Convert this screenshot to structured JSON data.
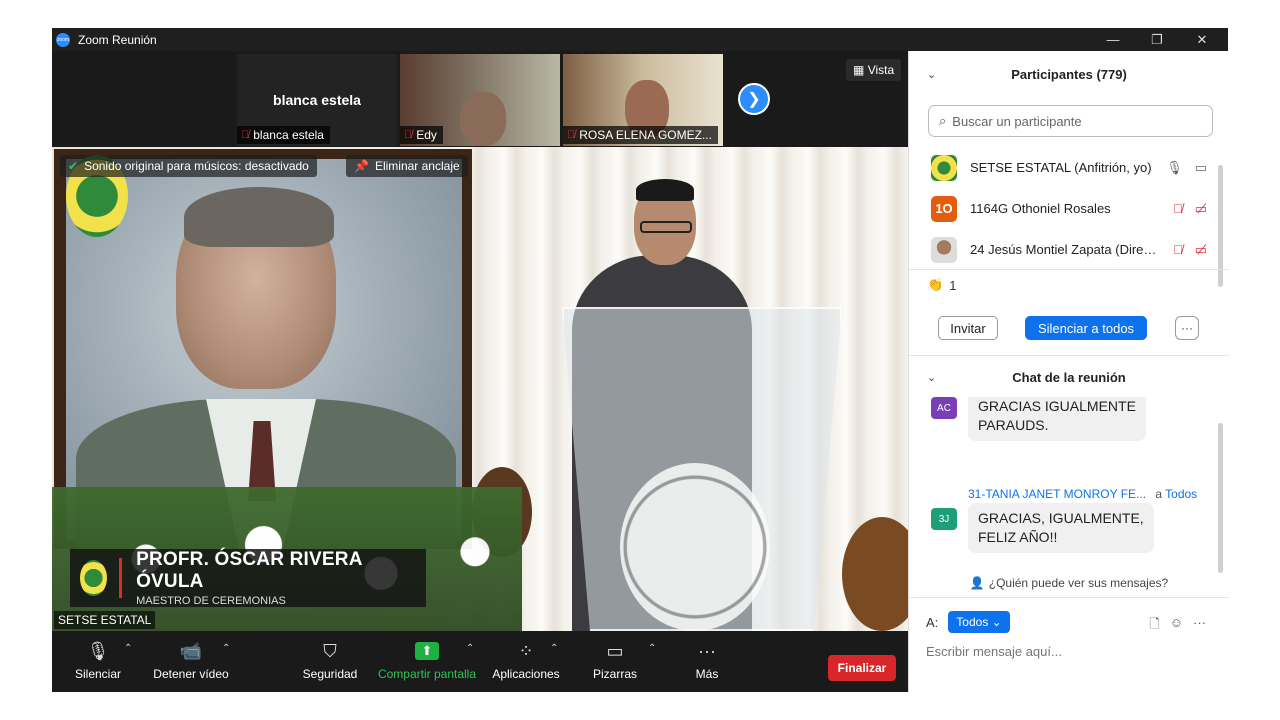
{
  "window": {
    "title": "Zoom Reunión",
    "controls": [
      "—",
      "❐",
      "✕"
    ]
  },
  "gallery": {
    "tiles": [
      {
        "big_name": "blanca estela",
        "label": "blanca estela"
      },
      {
        "label": "Edy"
      },
      {
        "label": "ROSA ELENA GOMEZ..."
      }
    ],
    "view_label": "Vista"
  },
  "main_video": {
    "badge_original_sound": "Sonido original para músicos: desactivado",
    "badge_unpin": "Eliminar anclaje",
    "lower_third_name": "PROFR. ÓSCAR RIVERA ÓVULA",
    "lower_third_role": "MAESTRO DE CEREMONIAS",
    "speaker_name": "SETSE ESTATAL"
  },
  "toolbar": {
    "mute": "Silenciar",
    "stop_video": "Detener vídeo",
    "security": "Seguridad",
    "share": "Compartir pantalla",
    "apps": "Aplicaciones",
    "whiteboards": "Pizarras",
    "more": "Más",
    "end": "Finalizar"
  },
  "participants": {
    "header": "Participantes (779)",
    "search_placeholder": "Buscar un participante",
    "list": [
      {
        "name": "SETSE ESTATAL (Anfitrión, yo)",
        "avatar": "logo",
        "mic": "on",
        "video": "on"
      },
      {
        "name": "1164G Othoniel Rosales",
        "avatar": "1O",
        "avatar_color": "#e25d10",
        "mic": "off",
        "video": "off"
      },
      {
        "name": "24 Jesús Montiel Zapata (Direc...",
        "avatar": "photo",
        "mic": "off",
        "video": "off"
      }
    ],
    "reaction_count": "1",
    "invite": "Invitar",
    "mute_all": "Silenciar a todos",
    "more": "···"
  },
  "chat": {
    "header": "Chat de la reunión",
    "messages": [
      {
        "initials": "AC",
        "color": "#7a3fb8",
        "text_line1": "GRACIAS IGUALMENTE",
        "text_line2": "PARAUDS."
      },
      {
        "sender": "31-TANIA JANET MONROY FE...",
        "to_prefix": "a",
        "to": "Todos",
        "initials": "3J",
        "color": "#1f9e7a",
        "text_line1": "GRACIAS, IGUALMENTE,",
        "text_line2": "FELIZ AÑO!!"
      }
    ],
    "who_can_see": "¿Quién puede ver sus mensajes?",
    "to_label": "A:",
    "to_value": "Todos",
    "input_placeholder": "Escribir mensaje aquí..."
  },
  "colors": {
    "accent": "#0e72ed",
    "end": "#d9262b",
    "share": "#1fb141",
    "muted": "#e02f44"
  }
}
